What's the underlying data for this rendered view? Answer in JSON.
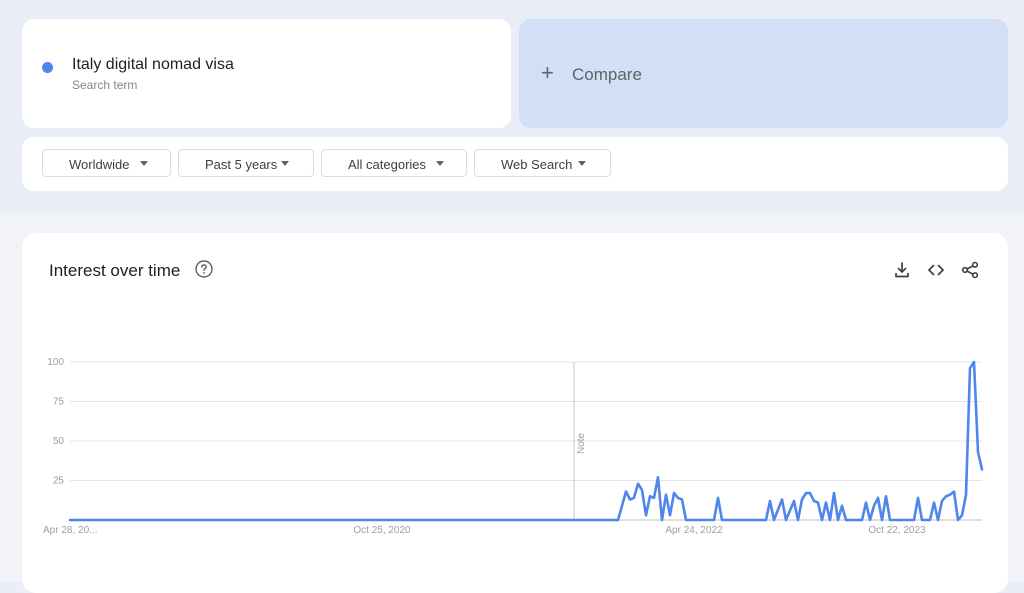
{
  "search_term": {
    "name": "Italy digital nomad visa",
    "subtitle": "Search term",
    "color": "#4f86ec"
  },
  "compare": {
    "plus": "+",
    "label": "Compare"
  },
  "filters": {
    "region": "Worldwide",
    "time_range": "Past 5 years",
    "category": "All categories",
    "search_type": "Web Search"
  },
  "panel": {
    "title": "Interest over time",
    "icons": [
      "help-icon",
      "download-icon",
      "embed-code-icon",
      "share-icon"
    ]
  },
  "chart_data": {
    "type": "line",
    "title": "",
    "xlabel": "",
    "ylabel": "",
    "ylim": [
      0,
      100
    ],
    "yticks": [
      25,
      50,
      75,
      100
    ],
    "x_tick_labels": [
      "Apr 28, 20...",
      "Oct 25, 2020",
      "Apr 24, 2022",
      "Oct 22, 2023"
    ],
    "grid": true,
    "annotation": {
      "text": "Note",
      "at_week": 126
    },
    "series": [
      {
        "name": "",
        "color": "#4f86ec",
        "x_unit": "weeks since Apr 28, 2019",
        "points": [
          [
            0,
            0
          ],
          [
            137,
            0
          ],
          [
            139,
            18
          ],
          [
            140,
            13
          ],
          [
            141,
            14
          ],
          [
            142,
            23
          ],
          [
            143,
            19
          ],
          [
            144,
            3
          ],
          [
            145,
            15
          ],
          [
            146,
            14
          ],
          [
            147,
            27
          ],
          [
            148,
            0
          ],
          [
            149,
            16
          ],
          [
            150,
            3
          ],
          [
            151,
            17
          ],
          [
            152,
            14
          ],
          [
            153,
            13
          ],
          [
            154,
            0
          ],
          [
            158,
            0
          ],
          [
            161,
            0
          ],
          [
            162,
            14
          ],
          [
            163,
            0
          ],
          [
            174,
            0
          ],
          [
            175,
            12
          ],
          [
            176,
            0
          ],
          [
            178,
            13
          ],
          [
            179,
            0
          ],
          [
            181,
            12
          ],
          [
            182,
            0
          ],
          [
            183,
            13
          ],
          [
            184,
            17
          ],
          [
            185,
            17
          ],
          [
            186,
            12
          ],
          [
            187,
            11
          ],
          [
            188,
            0
          ],
          [
            189,
            11
          ],
          [
            190,
            0
          ],
          [
            191,
            17
          ],
          [
            192,
            0
          ],
          [
            193,
            9
          ],
          [
            194,
            0
          ],
          [
            198,
            0
          ],
          [
            199,
            11
          ],
          [
            200,
            0
          ],
          [
            201,
            9
          ],
          [
            202,
            14
          ],
          [
            203,
            0
          ],
          [
            204,
            15
          ],
          [
            205,
            0
          ],
          [
            211,
            0
          ],
          [
            212,
            14
          ],
          [
            213,
            0
          ],
          [
            215,
            0
          ],
          [
            216,
            11
          ],
          [
            217,
            0
          ],
          [
            218,
            12
          ],
          [
            219,
            15
          ],
          [
            220,
            16
          ],
          [
            221,
            18
          ],
          [
            222,
            0
          ],
          [
            223,
            3
          ],
          [
            224,
            16
          ],
          [
            225,
            96
          ],
          [
            226,
            100
          ],
          [
            227,
            43
          ],
          [
            228,
            32
          ]
        ]
      }
    ]
  }
}
